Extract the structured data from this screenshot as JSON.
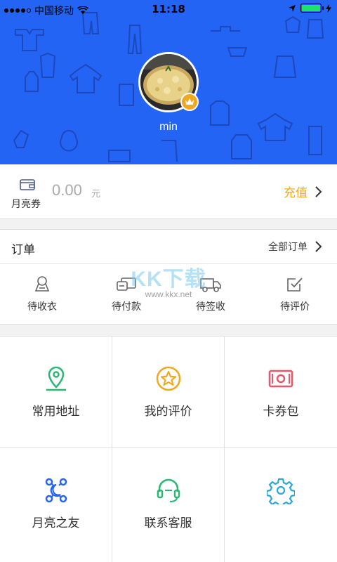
{
  "status_bar": {
    "carrier": "中国移动",
    "time": "11:18"
  },
  "profile": {
    "username": "min"
  },
  "wallet": {
    "label": "月亮券",
    "amount": "0.00",
    "unit": "元",
    "recharge_label": "充值"
  },
  "orders": {
    "title": "订单",
    "all_label": "全部订单",
    "items": [
      {
        "label": "待收衣",
        "icon": "pickup-icon"
      },
      {
        "label": "待付款",
        "icon": "payment-icon"
      },
      {
        "label": "待签收",
        "icon": "delivery-truck-icon"
      },
      {
        "label": "待评价",
        "icon": "review-check-icon"
      }
    ]
  },
  "grid": {
    "items": [
      {
        "label": "常用地址",
        "icon": "location-pin-icon",
        "color": "#2bb673"
      },
      {
        "label": "我的评价",
        "icon": "star-circle-icon",
        "color": "#f0a91e"
      },
      {
        "label": "卡券包",
        "icon": "cash-ticket-icon",
        "color": "#e8566a"
      },
      {
        "label": "月亮之友",
        "icon": "network-icon",
        "color": "#2464f5"
      },
      {
        "label": "联系客服",
        "icon": "headset-icon",
        "color": "#2bb673"
      },
      {
        "label": "",
        "icon": "settings-gear-icon",
        "color": "#2aa7d8"
      }
    ]
  },
  "watermark": {
    "main": "KK下载",
    "url": "www.kkx.net"
  },
  "colors": {
    "header_blue": "#2464f5",
    "accent_orange": "#f0a91e"
  }
}
